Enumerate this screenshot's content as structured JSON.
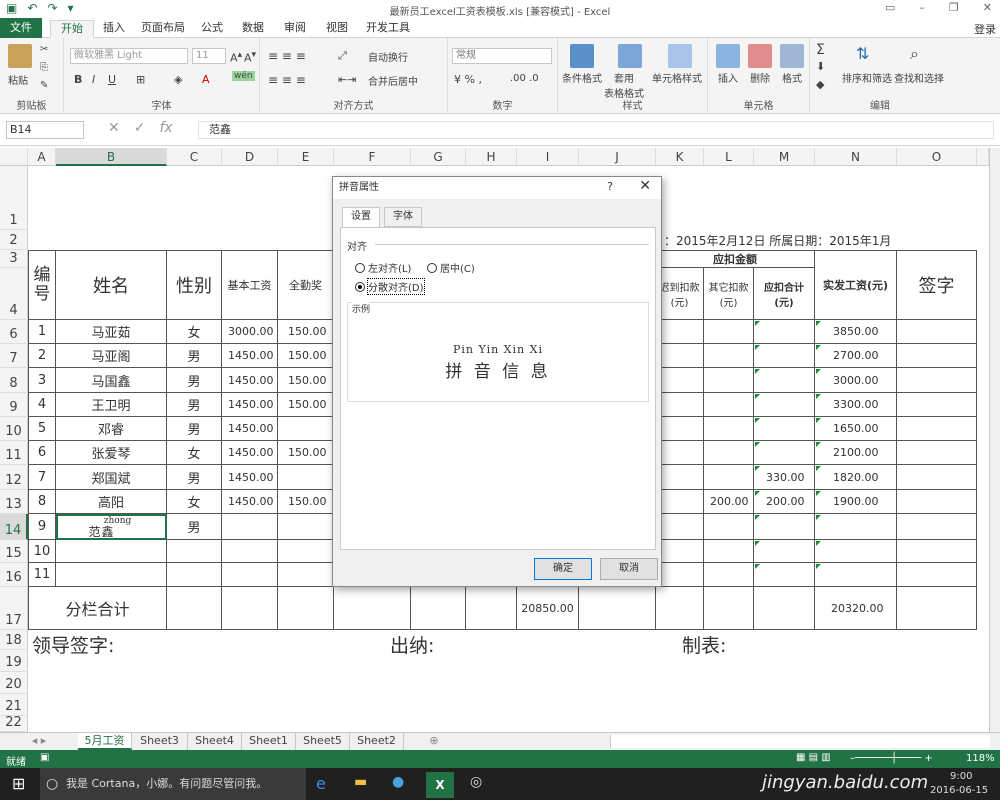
{
  "app": {
    "title": "最新员工excel工资表模板.xls  [兼容模式] - Excel",
    "login": "登录"
  },
  "tabs": [
    "文件",
    "开始",
    "插入",
    "页面布局",
    "公式",
    "数据",
    "审阅",
    "视图",
    "开发工具"
  ],
  "ribbon": {
    "clipboard": {
      "label": "剪贴板",
      "paste": "粘贴"
    },
    "font": {
      "label": "字体",
      "name": "微软雅黑 Light",
      "size": "11"
    },
    "alignment": {
      "label": "对齐方式",
      "wrap": "自动换行",
      "merge": "合并后居中"
    },
    "number": {
      "label": "数字",
      "format": "常规"
    },
    "styles": {
      "label": "样式",
      "cond": "条件格式",
      "table": "套用\n表格格式",
      "cellstyle": "单元格样式"
    },
    "cells": {
      "label": "单元格",
      "insert": "插入",
      "delete": "删除",
      "format": "格式"
    },
    "editing": {
      "label": "编辑",
      "sort": "排序和筛选",
      "find": "查找和选择"
    }
  },
  "formula_bar": {
    "name_box": "B14",
    "formula": "范鑫",
    "fx": "fx"
  },
  "columns": [
    "A",
    "B",
    "C",
    "D",
    "E",
    "F",
    "G",
    "H",
    "I",
    "J",
    "K",
    "L",
    "M",
    "N",
    "O"
  ],
  "rows": [
    "1",
    "2",
    "3",
    "4",
    "6",
    "7",
    "8",
    "9",
    "10",
    "11",
    "12",
    "13",
    "14",
    "15",
    "16",
    "17",
    "18",
    "19",
    "20",
    "21",
    "22"
  ],
  "sheet": {
    "date_line": "：2015年2月12日 所属日期：2015年1月",
    "header": {
      "id": "编号",
      "name": "姓名",
      "gender": "性别",
      "base": "基本工资",
      "attendance": "全勤奖",
      "deduct_group": "应扣金额",
      "late": "迟到扣款\n(元)",
      "other": "其它扣款\n(元)",
      "total_deduct": "应扣合计\n(元)",
      "net": "实发工资(元)",
      "sign": "签字"
    },
    "employees": [
      {
        "id": "1",
        "name": "马亚茹",
        "gender": "女",
        "base": "3000.00",
        "att": "150.00",
        "other": "",
        "total": "",
        "net": "3850.00"
      },
      {
        "id": "2",
        "name": "马亚阁",
        "gender": "男",
        "base": "1450.00",
        "att": "150.00",
        "other": "",
        "total": "",
        "net": "2700.00"
      },
      {
        "id": "3",
        "name": "马国鑫",
        "gender": "男",
        "base": "1450.00",
        "att": "150.00",
        "other": "",
        "total": "",
        "net": "3000.00"
      },
      {
        "id": "4",
        "name": "王卫明",
        "gender": "男",
        "base": "1450.00",
        "att": "150.00",
        "other": "",
        "total": "",
        "net": "3300.00"
      },
      {
        "id": "5",
        "name": "邓睿",
        "gender": "男",
        "base": "1450.00",
        "att": "",
        "other": "",
        "total": "",
        "net": "1650.00"
      },
      {
        "id": "6",
        "name": "张爱琴",
        "gender": "女",
        "base": "1450.00",
        "att": "150.00",
        "other": "",
        "total": "",
        "net": "2100.00"
      },
      {
        "id": "7",
        "name": "郑国斌",
        "gender": "男",
        "base": "1450.00",
        "att": "",
        "other": "",
        "total": "330.00",
        "net": "1820.00"
      },
      {
        "id": "8",
        "name": "高阳",
        "gender": "女",
        "base": "1450.00",
        "att": "150.00",
        "other": "200.00",
        "total": "200.00",
        "net": "1900.00"
      },
      {
        "id": "9",
        "name": "范鑫",
        "pinyin": "zhong",
        "gender": "男",
        "base": "",
        "att": "",
        "other": "",
        "total": "",
        "net": ""
      },
      {
        "id": "10",
        "name": "",
        "gender": "",
        "base": "",
        "att": "",
        "other": "",
        "total": "",
        "net": ""
      },
      {
        "id": "11",
        "name": "",
        "gender": "",
        "base": "",
        "att": "",
        "other": "",
        "total": "",
        "net": ""
      }
    ],
    "subtotal": {
      "label": "分栏合计",
      "i_value": "20850.00",
      "net": "20320.00"
    },
    "footer": {
      "leader": "领导签字:",
      "cashier": "出纳:",
      "maker": "制表:"
    }
  },
  "sheet_tabs": [
    "5月工资",
    "Sheet3",
    "Sheet4",
    "Sheet1",
    "Sheet5",
    "Sheet2"
  ],
  "status": {
    "ready": "就绪",
    "zoom": "118%"
  },
  "taskbar": {
    "cortana": "我是 Cortana，小娜。有问题尽管问我。",
    "time": "9:00",
    "date": "2016-06-15",
    "watermark": "jingyan.baidu.com"
  },
  "dialog": {
    "title": "拼音属性",
    "help": "?",
    "close": "✕",
    "tabs": [
      "设置",
      "字体"
    ],
    "align_label": "对齐",
    "options": [
      "左对齐(L)",
      "居中(C)",
      "分散对齐(D)"
    ],
    "selected": "分散对齐(D)",
    "sample_label": "示例",
    "sample_pinyin": "Pin Yin Xin Xi",
    "sample_text": "拼 音 信 息",
    "ok": "确定",
    "cancel": "取消"
  }
}
